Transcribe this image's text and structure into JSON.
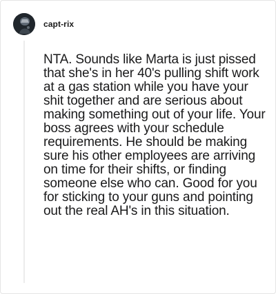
{
  "comment": {
    "username": "capt-rix",
    "avatar_icon": "avatar-icon",
    "body": "NTA. Sounds like Marta is just pissed that she's in her 40's pulling shift work at a gas station while you have your shit together and are serious about making something out of your life. Your boss agrees with your schedule requirements. He should be making sure his other employees are arriving on time for their shifts, or finding someone else who can. Good for you for sticking to your guns and pointing out the real AH's in this situation."
  },
  "colors": {
    "text": "#1a1a1b",
    "thread_line": "#ececec",
    "border": "#e4e4e4"
  }
}
